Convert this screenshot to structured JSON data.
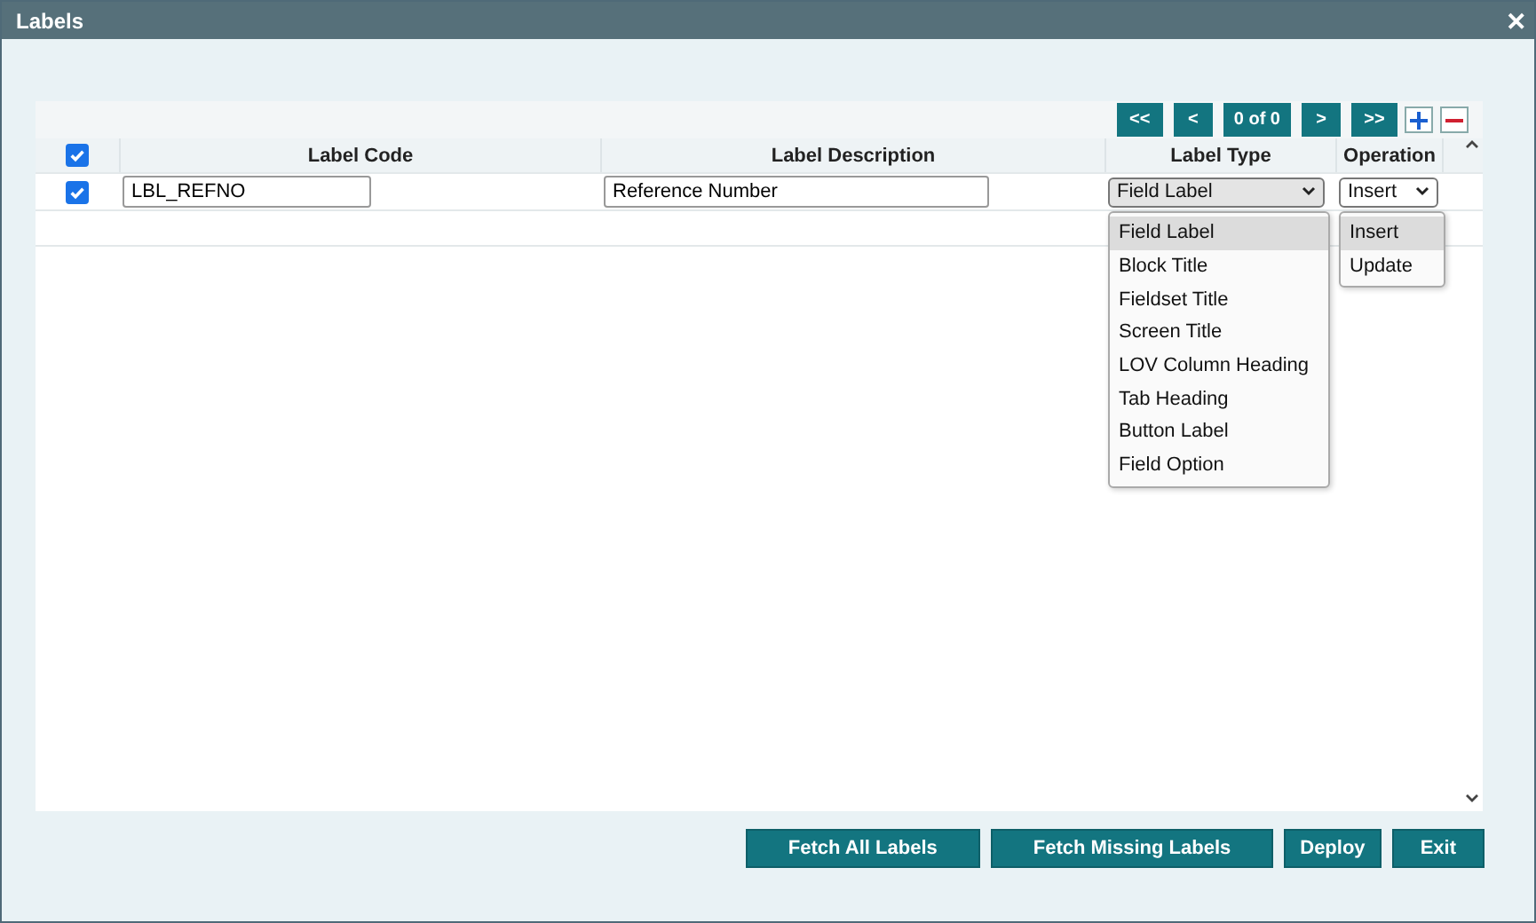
{
  "window": {
    "title": "Labels",
    "close": "✕"
  },
  "pager": {
    "first": "<<",
    "prev": "<",
    "status": "0 of 0",
    "next": ">",
    "last": ">>"
  },
  "table": {
    "select_all": {
      "checked": true
    },
    "columns": [
      "Label Code",
      "Label Description",
      "Label Type",
      "Operation"
    ],
    "rows": [
      {
        "checked": true,
        "label_code": "LBL_REFNO",
        "label_description": "Reference Number",
        "label_type": "Field Label",
        "operation": "Insert"
      }
    ]
  },
  "label_type_menu": [
    {
      "label": "Field Label",
      "selected": true
    },
    {
      "label": "Block Title",
      "selected": false
    },
    {
      "label": "Fieldset Title",
      "selected": false
    },
    {
      "label": "Screen Title",
      "selected": false
    },
    {
      "label": "LOV Column Heading",
      "selected": false
    },
    {
      "label": "Tab Heading",
      "selected": false
    },
    {
      "label": "Button Label",
      "selected": false
    },
    {
      "label": "Field Option",
      "selected": false
    }
  ],
  "operation_menu": [
    {
      "label": "Insert",
      "selected": true
    },
    {
      "label": "Update",
      "selected": false
    }
  ],
  "buttons": [
    "Fetch All Labels",
    "Fetch Missing Labels",
    "Deploy",
    "Exit"
  ]
}
